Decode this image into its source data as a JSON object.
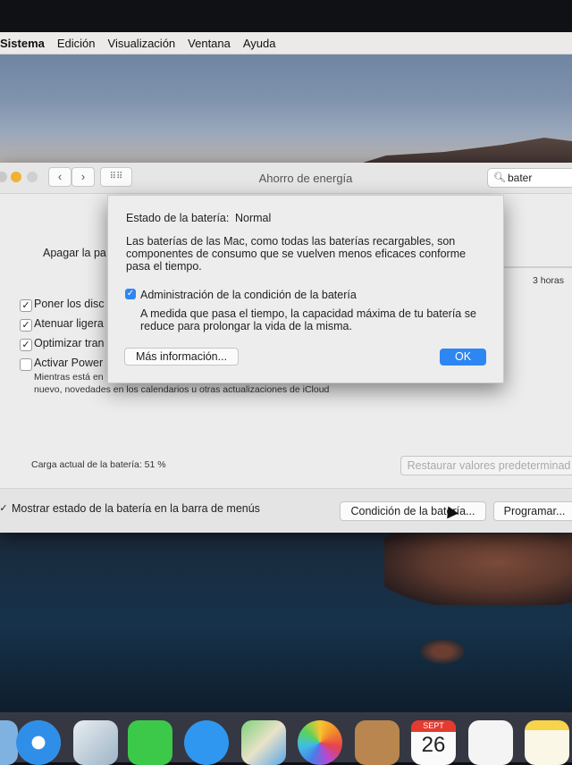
{
  "menubar": {
    "items": [
      "Sistema",
      "Edición",
      "Visualización",
      "Ventana",
      "Ayuda"
    ]
  },
  "window": {
    "title": "Ahorro de energía",
    "search_value": "bater",
    "apagar_label": "Apagar la pa",
    "slider_label": "3 horas",
    "options": [
      {
        "label": "Poner los disc",
        "checked": true
      },
      {
        "label": "Atenuar ligera",
        "checked": true
      },
      {
        "label": "Optimizar tran",
        "checked": true
      },
      {
        "label": "Activar Power",
        "checked": false
      }
    ],
    "power_note_1": "Mientras está en",
    "power_note_2": "nuevo, novedades en los calendarios u otras actualizaciones de iCloud",
    "charge_label": "Carga actual de la batería: 51 %",
    "restore_button": "Restaurar valores predeterminad",
    "show_status_label": "Mostrar estado de la batería en la barra de menús",
    "show_status_checked": true,
    "condition_button": "Condición de la batería...",
    "schedule_button": "Programar..."
  },
  "sheet": {
    "status_label": "Estado de la batería:",
    "status_value": "Normal",
    "desc_lines": [
      "Las baterías de las Mac, como todas las baterías recargables, son",
      "componentes de consumo que se vuelven menos eficaces conforme",
      "pasa el tiempo."
    ],
    "management_label": "Administración de la condición de la batería",
    "management_checked": true,
    "management_desc_lines": [
      "A medida que pasa el tiempo, la capacidad máxima de tu batería se",
      "reduce para prolongar la vida de la misma."
    ],
    "more_info_button": "Más información...",
    "ok_button": "OK"
  },
  "dock": {
    "calendar_month": "SEPT",
    "calendar_day": "26",
    "icons": [
      "finder-icon",
      "safari-icon",
      "mail-icon",
      "facetime-icon",
      "messages-icon",
      "maps-icon",
      "photos-icon",
      "contacts-icon",
      "calendar-icon",
      "reminders-icon",
      "notes-icon"
    ]
  }
}
